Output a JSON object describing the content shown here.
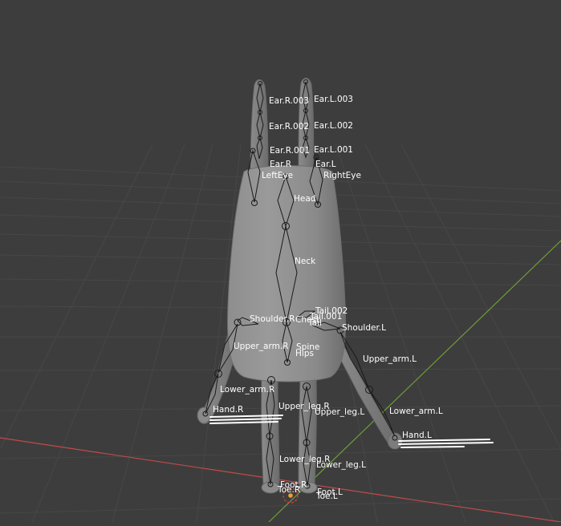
{
  "viewport": {
    "background": "#3d3d3d",
    "grid_color": "#474747",
    "x_axis_color": "#c24a4a",
    "y_axis_color": "#6f9c3a",
    "mesh_color": "#8a8a8a",
    "bone_color": "#1a1a1a"
  },
  "bones": {
    "ear_r_003": "Ear.R.003",
    "ear_l_003": "Ear.L.003",
    "ear_r_002": "Ear.R.002",
    "ear_l_002": "Ear.L.002",
    "ear_r_001": "Ear.R.001",
    "ear_l_001": "Ear.L.001",
    "ear_r": "Ear.R",
    "ear_l": "Ear.L",
    "left_eye": "LeftEye",
    "right_eye": "RightEye",
    "head": "Head",
    "neck": "Neck",
    "tail_002": "Tail.002",
    "tail_001": "Tail.001",
    "chest": "Chest",
    "tail": "Tail",
    "shoulder_r": "Shoulder.R",
    "shoulder_l": "Shoulder.L",
    "upper_arm_r": "Upper_arm.R",
    "spine": "Spine",
    "hips": "Hips",
    "upper_arm_l": "Upper_arm.L",
    "lower_arm_r": "Lower_arm.R",
    "upper_leg_r": "Upper_leg.R",
    "upper_leg_l": "Upper_leg.L",
    "lower_arm_l": "Lower_arm.L",
    "hand_r": "Hand.R",
    "hand_l": "Hand.L",
    "lower_leg_r": "Lower_leg.R",
    "lower_leg_l": "Lower_leg.L",
    "foot_r": "Foot.R",
    "toe_r": "Toe.R",
    "foot_l": "Foot.L",
    "toe_l": "Toe.L"
  }
}
